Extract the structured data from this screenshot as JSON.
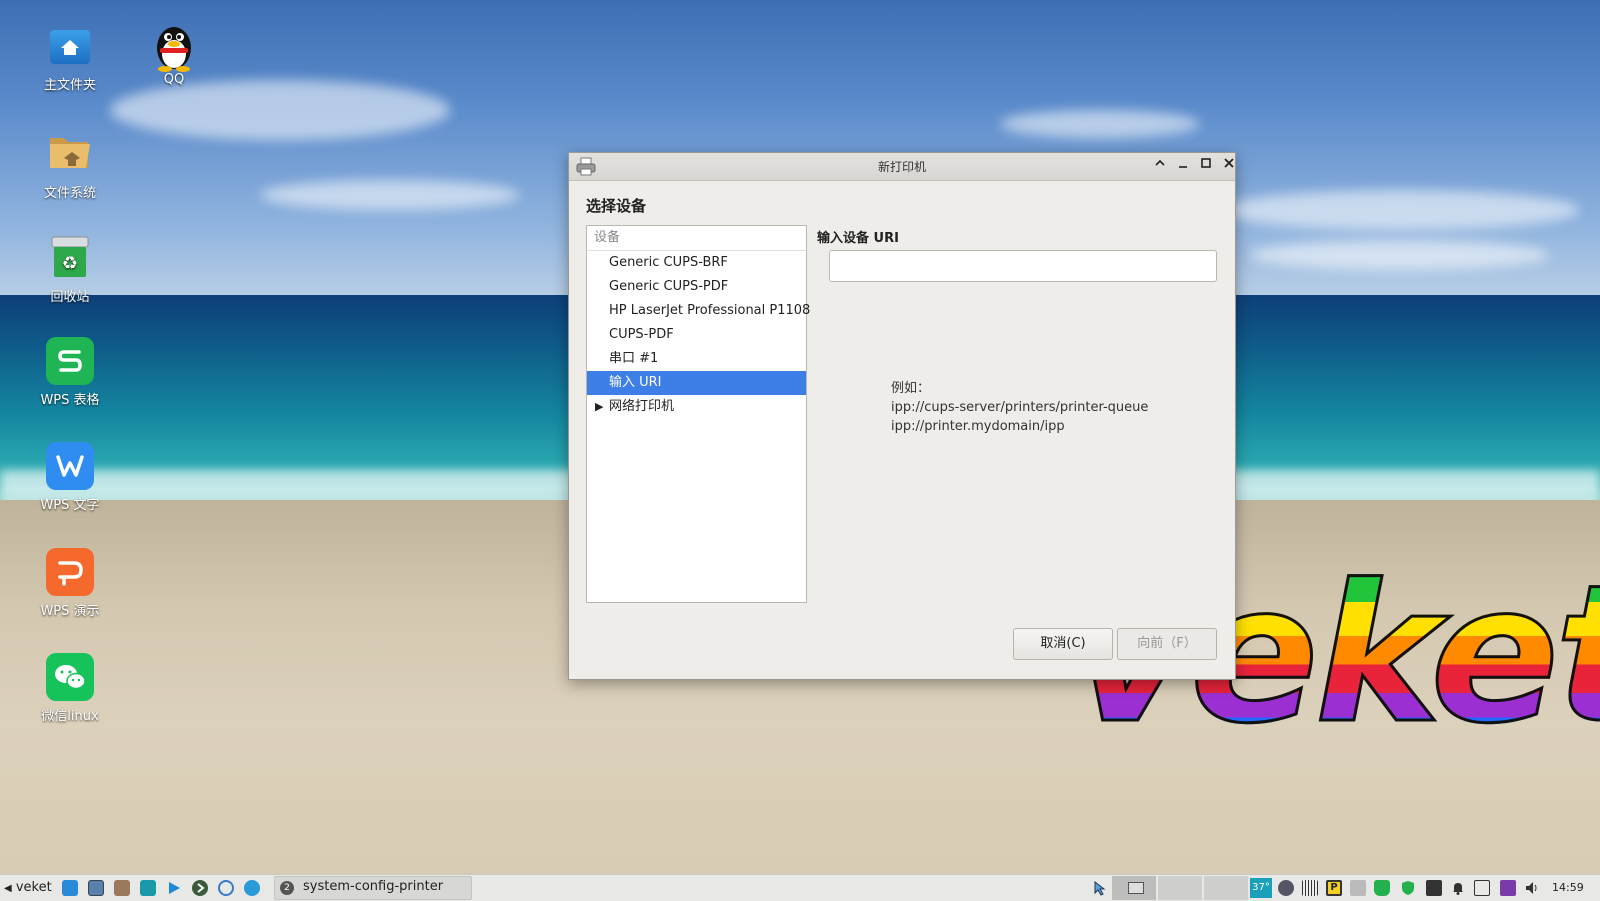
{
  "desktop": {
    "icons": [
      {
        "label": "主文件夹"
      },
      {
        "label": "QQ"
      },
      {
        "label": "文件系统"
      },
      {
        "label": "回收站"
      },
      {
        "label": "WPS 表格"
      },
      {
        "label": "WPS 文字"
      },
      {
        "label": "WPS 演示"
      },
      {
        "label": "微信linux"
      }
    ],
    "wallpaper_text": "veket"
  },
  "dialog": {
    "title": "新打印机",
    "section_title": "选择设备",
    "device_list": {
      "header": "设备",
      "items": [
        {
          "label": "Generic CUPS-BRF"
        },
        {
          "label": "Generic CUPS-PDF"
        },
        {
          "label": "HP LaserJet Professional P1108"
        },
        {
          "label": "CUPS-PDF"
        },
        {
          "label": "串口 #1"
        },
        {
          "label": "输入 URI",
          "selected": true
        },
        {
          "label": "网络打印机",
          "expandable": true
        }
      ]
    },
    "uri_label": "输入设备 URI",
    "uri_value": "",
    "example_heading": "例如：",
    "example_lines": [
      "ipp://cups-server/printers/printer-queue",
      "ipp://printer.mydomain/ipp"
    ],
    "cancel_label": "取消(C)",
    "forward_label": "向前（F）",
    "titlebar_buttons": {
      "up": "⌃",
      "minimize": "_",
      "maximize": "□",
      "close": "✕"
    }
  },
  "taskbar": {
    "menu_label": "veket",
    "task_label": "system-config-printer",
    "task_badge": "2",
    "temperature": "37°",
    "clock": "14:59"
  },
  "colors": {
    "selection": "#3d7fe6",
    "dialog_bg": "#efedea",
    "taskbar_bg": "#e8e8e6"
  }
}
